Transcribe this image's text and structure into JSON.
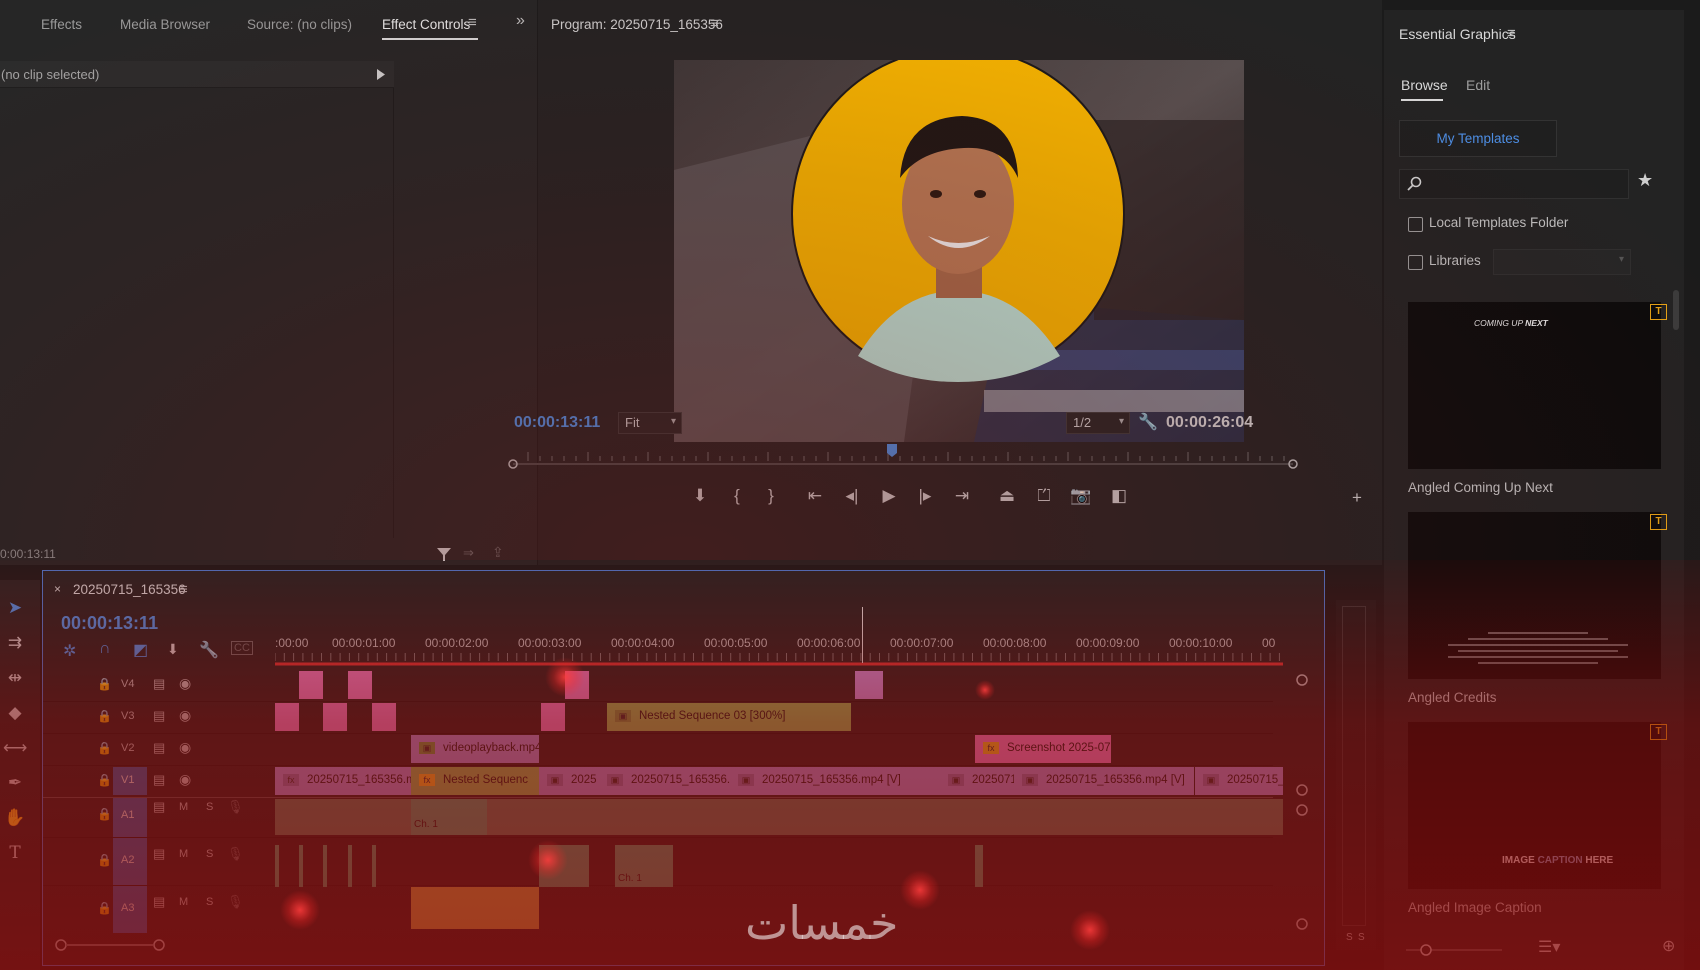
{
  "effect_panel": {
    "tabs": [
      "Effects",
      "Media Browser",
      "Source: (no clips)",
      "Effect Controls"
    ],
    "active_tab": "Effect Controls",
    "clip_status": "(no clip selected)",
    "timecode": "0:00:13:11"
  },
  "program_monitor": {
    "title": "Program: 20250715_165356",
    "current_time": "00:00:13:11",
    "fit_label": "Fit",
    "resolution_label": "1/2",
    "duration": "00:00:26:04"
  },
  "essential_graphics": {
    "title": "Essential Graphics",
    "tabs": [
      "Browse",
      "Edit"
    ],
    "my_templates": "My Templates",
    "local_folder": "Local Templates Folder",
    "libraries": "Libraries",
    "templates": [
      {
        "name": "Angled Coming Up Next",
        "thumb_text_a": "COMING UP",
        "thumb_text_b": "NEXT"
      },
      {
        "name": "Angled Credits"
      },
      {
        "name": "Angled Image Caption",
        "thumb_text_a": "IMAGE",
        "thumb_text_b": "CAPTION",
        "thumb_text_c": "HERE"
      }
    ],
    "badge": "T"
  },
  "timeline": {
    "sequence_name": "20250715_165356",
    "timecode": "00:00:13:11",
    "ruler": [
      ":00:00",
      "00:00:01:00",
      "00:00:02:00",
      "00:00:03:00",
      "00:00:04:00",
      "00:00:05:00",
      "00:00:06:00",
      "00:00:07:00",
      "00:00:08:00",
      "00:00:09:00",
      "00:00:10:00",
      "00"
    ],
    "video_tracks": [
      "V4",
      "V3",
      "V2",
      "V1"
    ],
    "audio_tracks": [
      "A1",
      "A2",
      "A3"
    ],
    "audio_buttons": {
      "mute": "M",
      "solo": "S"
    },
    "clips": {
      "nested03": "Nested Sequence 03 [300%]",
      "videoplayback": "videoplayback.mp4 [",
      "screenshot": "Screenshot 2025-07-15",
      "v1_a": "20250715_165356.mp",
      "v1_nested": "Nested Sequenc",
      "v1_b": "2025",
      "v1_c": "20250715_165356.mp",
      "v1_d": "20250715_165356.mp4 [V]",
      "v1_e": "2025071",
      "v1_f": "20250715_165356.mp4 [V]",
      "v1_g": "20250715_",
      "audio_ch1": "Ch. 1"
    },
    "meter_labels": [
      "S",
      "S"
    ]
  },
  "watermark": "خمسات",
  "colors": {
    "accent_blue": "#4a90e2",
    "clip_pink": "#e580c7",
    "clip_green": "#8ab65a",
    "clip_violet": "#a48fd2",
    "badge_gold": "#e7a316",
    "portrait_circle": "#f8b700"
  }
}
